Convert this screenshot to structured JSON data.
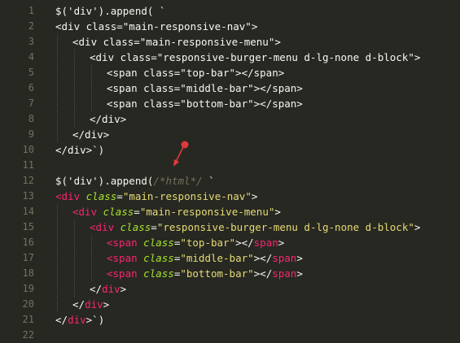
{
  "editor": {
    "colors": {
      "background": "#272822",
      "default": "#f8f8f2",
      "string": "#e6db74",
      "tag": "#f92672",
      "attr": "#a6e22e",
      "comment": "#75715e",
      "linenumber": "#75715e",
      "arrow": "#e0393e"
    },
    "lines": [
      {
        "num": "1",
        "indent": 0,
        "tokens": [
          {
            "t": "$('div').append( `",
            "c": "default"
          }
        ]
      },
      {
        "num": "2",
        "indent": 0,
        "tokens": [
          {
            "t": "<div class=\"main-responsive-nav\">",
            "c": "default"
          }
        ]
      },
      {
        "num": "3",
        "indent": 1,
        "tokens": [
          {
            "t": "<div class=\"main-responsive-menu\">",
            "c": "default"
          }
        ]
      },
      {
        "num": "4",
        "indent": 2,
        "tokens": [
          {
            "t": "<div class=\"responsive-burger-menu d-lg-none d-block\">",
            "c": "default"
          }
        ]
      },
      {
        "num": "5",
        "indent": 3,
        "tokens": [
          {
            "t": "<span class=\"top-bar\"></span>",
            "c": "default"
          }
        ]
      },
      {
        "num": "6",
        "indent": 3,
        "tokens": [
          {
            "t": "<span class=\"middle-bar\"></span>",
            "c": "default"
          }
        ]
      },
      {
        "num": "7",
        "indent": 3,
        "tokens": [
          {
            "t": "<span class=\"bottom-bar\"></span>",
            "c": "default"
          }
        ]
      },
      {
        "num": "8",
        "indent": 2,
        "tokens": [
          {
            "t": "</div>",
            "c": "default"
          }
        ]
      },
      {
        "num": "9",
        "indent": 1,
        "tokens": [
          {
            "t": "</div>",
            "c": "default"
          }
        ]
      },
      {
        "num": "10",
        "indent": 0,
        "tokens": [
          {
            "t": "</div>`)",
            "c": "default"
          }
        ]
      },
      {
        "num": "11",
        "indent": 0,
        "tokens": []
      },
      {
        "num": "12",
        "indent": 0,
        "tokens": [
          {
            "t": "$('div').append(",
            "c": "default"
          },
          {
            "t": "/*html*/",
            "c": "comment"
          },
          {
            "t": " `",
            "c": "default"
          }
        ]
      },
      {
        "num": "13",
        "indent": 0,
        "tokens": [
          {
            "t": "<div",
            "c": "tag"
          },
          {
            "t": " ",
            "c": "default"
          },
          {
            "t": "class",
            "c": "attr"
          },
          {
            "t": "=",
            "c": "default"
          },
          {
            "t": "\"main-responsive-nav\"",
            "c": "string"
          },
          {
            "t": ">",
            "c": "default"
          }
        ]
      },
      {
        "num": "14",
        "indent": 1,
        "tokens": [
          {
            "t": "<div",
            "c": "tag"
          },
          {
            "t": " ",
            "c": "default"
          },
          {
            "t": "class",
            "c": "attr"
          },
          {
            "t": "=",
            "c": "default"
          },
          {
            "t": "\"main-responsive-menu\"",
            "c": "string"
          },
          {
            "t": ">",
            "c": "default"
          }
        ]
      },
      {
        "num": "15",
        "indent": 2,
        "tokens": [
          {
            "t": "<div",
            "c": "tag"
          },
          {
            "t": " ",
            "c": "default"
          },
          {
            "t": "class",
            "c": "attr"
          },
          {
            "t": "=",
            "c": "default"
          },
          {
            "t": "\"responsive-burger-menu d-lg-none d-block\"",
            "c": "string"
          },
          {
            "t": ">",
            "c": "default"
          }
        ]
      },
      {
        "num": "16",
        "indent": 3,
        "tokens": [
          {
            "t": "<span",
            "c": "tag"
          },
          {
            "t": " ",
            "c": "default"
          },
          {
            "t": "class",
            "c": "attr"
          },
          {
            "t": "=",
            "c": "default"
          },
          {
            "t": "\"top-bar\"",
            "c": "string"
          },
          {
            "t": "></",
            "c": "default"
          },
          {
            "t": "span",
            "c": "tag"
          },
          {
            "t": ">",
            "c": "default"
          }
        ]
      },
      {
        "num": "17",
        "indent": 3,
        "tokens": [
          {
            "t": "<span",
            "c": "tag"
          },
          {
            "t": " ",
            "c": "default"
          },
          {
            "t": "class",
            "c": "attr"
          },
          {
            "t": "=",
            "c": "default"
          },
          {
            "t": "\"middle-bar\"",
            "c": "string"
          },
          {
            "t": "></",
            "c": "default"
          },
          {
            "t": "span",
            "c": "tag"
          },
          {
            "t": ">",
            "c": "default"
          }
        ]
      },
      {
        "num": "18",
        "indent": 3,
        "tokens": [
          {
            "t": "<span",
            "c": "tag"
          },
          {
            "t": " ",
            "c": "default"
          },
          {
            "t": "class",
            "c": "attr"
          },
          {
            "t": "=",
            "c": "default"
          },
          {
            "t": "\"bottom-bar\"",
            "c": "string"
          },
          {
            "t": "></",
            "c": "default"
          },
          {
            "t": "span",
            "c": "tag"
          },
          {
            "t": ">",
            "c": "default"
          }
        ]
      },
      {
        "num": "19",
        "indent": 2,
        "tokens": [
          {
            "t": "</",
            "c": "default"
          },
          {
            "t": "div",
            "c": "tag"
          },
          {
            "t": ">",
            "c": "default"
          }
        ]
      },
      {
        "num": "20",
        "indent": 1,
        "tokens": [
          {
            "t": "</",
            "c": "default"
          },
          {
            "t": "div",
            "c": "tag"
          },
          {
            "t": ">",
            "c": "default"
          }
        ]
      },
      {
        "num": "21",
        "indent": 0,
        "tokens": [
          {
            "t": "</",
            "c": "default"
          },
          {
            "t": "div",
            "c": "tag"
          },
          {
            "t": ">`)",
            "c": "default"
          }
        ]
      },
      {
        "num": "22",
        "indent": 0,
        "tokens": []
      }
    ]
  }
}
